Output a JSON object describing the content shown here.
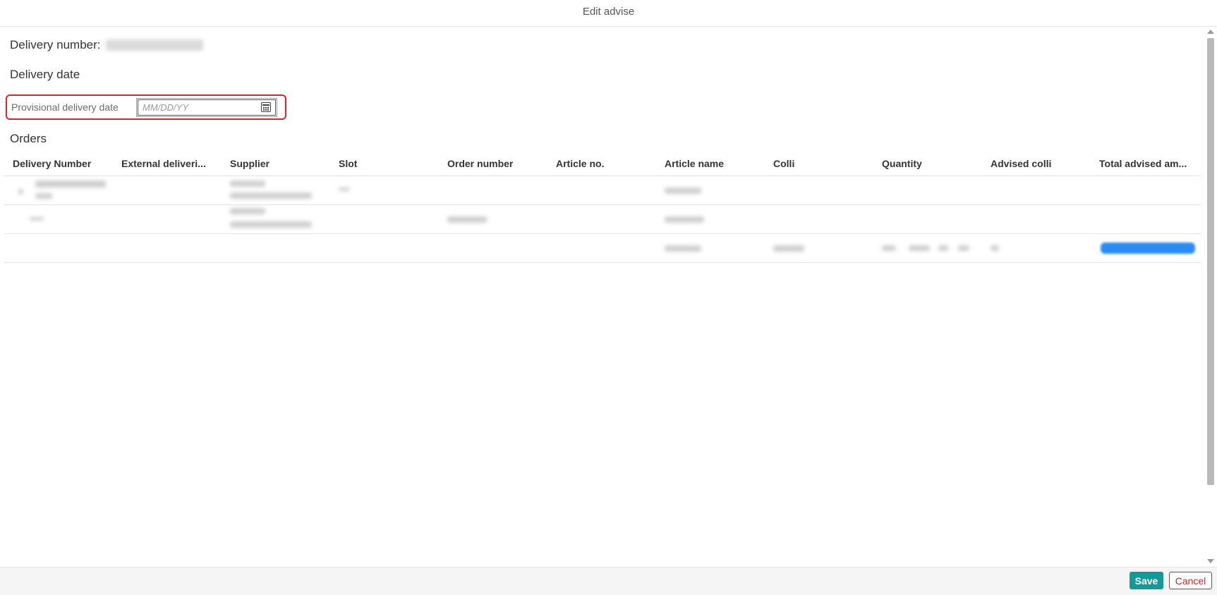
{
  "dialog": {
    "title": "Edit advise"
  },
  "delivery": {
    "number_label": "Delivery number:",
    "date_heading": "Delivery date",
    "provisional_label": "Provisional delivery date",
    "date_placeholder": "MM/DD/YY"
  },
  "orders": {
    "heading": "Orders",
    "columns": [
      "Delivery Number",
      "External deliveri...",
      "Supplier",
      "Slot",
      "Order number",
      "Article no.",
      "Article name",
      "Colli",
      "Quantity",
      "Advised colli",
      "Total advised am..."
    ]
  },
  "footer": {
    "save_label": "Save",
    "cancel_label": "Cancel"
  },
  "colors": {
    "accent": "#129a9a",
    "danger": "#d8232a",
    "highlight": "#e0242c",
    "progress": "#2a8cf0"
  },
  "icons": {
    "date_picker": "calendar-icon"
  }
}
